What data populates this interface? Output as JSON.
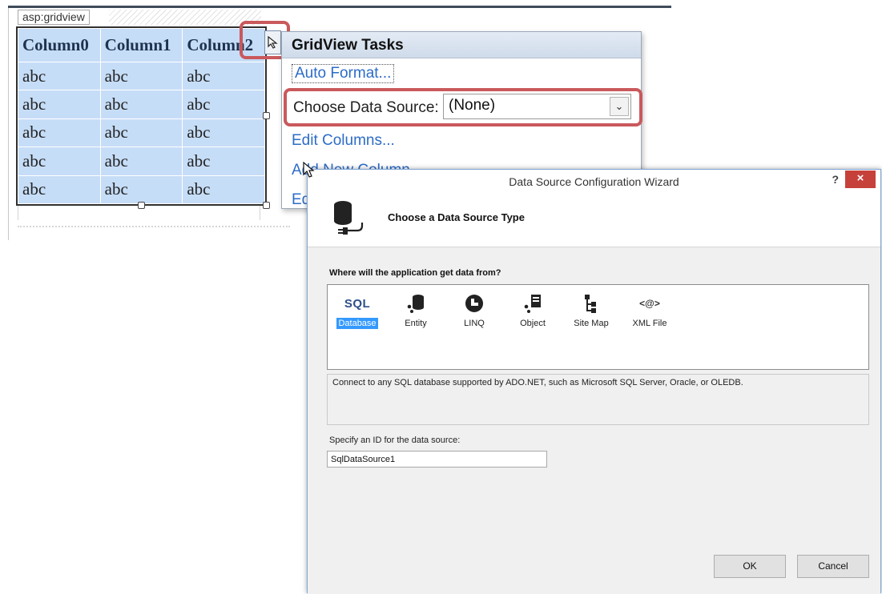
{
  "designer": {
    "tag_label": "asp:gridview",
    "grid": {
      "headers": [
        "Column0",
        "Column1",
        "Column2"
      ],
      "rows": [
        [
          "abc",
          "abc",
          "abc"
        ],
        [
          "abc",
          "abc",
          "abc"
        ],
        [
          "abc",
          "abc",
          "abc"
        ],
        [
          "abc",
          "abc",
          "abc"
        ],
        [
          "abc",
          "abc",
          "abc"
        ]
      ]
    }
  },
  "tasks_panel": {
    "title": "GridView Tasks",
    "auto_format": "Auto Format...",
    "choose_ds_label": "Choose Data Source:",
    "choose_ds_value": "(None)",
    "edit_columns": "Edit Columns...",
    "add_column_partial": "Add New Column...",
    "edit_partial": "Ed"
  },
  "wizard": {
    "title": "Data Source Configuration Wizard",
    "help": "?",
    "close": "×",
    "heading": "Choose a Data Source Type",
    "question": "Where will the application get data from?",
    "types": [
      {
        "label": "Database",
        "icon": "sql-database-icon",
        "icon_text": "SQL",
        "selected": true
      },
      {
        "label": "Entity",
        "icon": "entity-icon",
        "selected": false
      },
      {
        "label": "LINQ",
        "icon": "linq-icon",
        "selected": false
      },
      {
        "label": "Object",
        "icon": "object-icon",
        "selected": false
      },
      {
        "label": "Site Map",
        "icon": "site-map-icon",
        "selected": false
      },
      {
        "label": "XML File",
        "icon": "xml-file-icon",
        "icon_text": "<@>",
        "selected": false
      }
    ],
    "description": "Connect to any SQL database supported by ADO.NET, such as Microsoft SQL Server, Oracle, or OLEDB.",
    "id_label": "Specify an ID for the data source:",
    "id_value": "SqlDataSource1",
    "ok": "OK",
    "cancel": "Cancel"
  },
  "colors": {
    "highlight": "#c9595c",
    "grid_cell": "#c6ddf7",
    "link": "#2c6cc7",
    "selection": "#3399ff",
    "close": "#c7413b"
  }
}
